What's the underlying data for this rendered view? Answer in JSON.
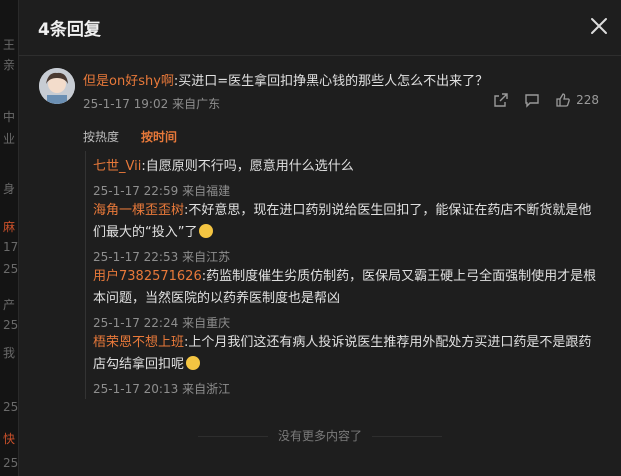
{
  "background_fragments": [
    "王",
    "亲",
    "中",
    "业",
    "身",
    "麻",
    "17",
    "25",
    "产",
    "25",
    "我",
    "25",
    "快",
    "25"
  ],
  "dialog": {
    "title": "4条回复"
  },
  "comment": {
    "user": "但是on好shy啊",
    "text": ":买进口=医生拿回扣挣黑心钱的那些人怎么不出来了？",
    "date": "25-1-17 19:02",
    "location": "来自广东",
    "likes": "228"
  },
  "sort": {
    "by_hot": "按热度",
    "by_time": "按时间"
  },
  "replies": [
    {
      "user": "七世_Vii",
      "text": ":自愿原则不行吗，愿意用什么选什么",
      "date": "25-1-17 22:59",
      "location": "来自福建"
    },
    {
      "user": "海角一棵歪歪树",
      "text": ":不好意思，现在进口药别说给医生回扣了，能保证在药店不断货就是他们最大的“投入”了",
      "date": "25-1-17 22:53",
      "location": "来自江苏"
    },
    {
      "user": "用户7382571626",
      "text": ":药监制度催生劣质仿制药，医保局又霸王硬上弓全面强制使用才是根本问题，当然医院的以药养医制度也是帮凶",
      "date": "25-1-17 22:24",
      "location": "来自重庆"
    },
    {
      "user": "梧荣恩不想上班",
      "text": ":上个月我们这还有病人投诉说医生推荐用外配处方买进口药是不是跟药店勾结拿回扣呢",
      "date": "25-1-17 20:13",
      "location": "来自浙江"
    }
  ],
  "footer": {
    "no_more": "没有更多内容了"
  },
  "colors": {
    "accent": "#e8793a",
    "background": "#1e1e1e"
  }
}
